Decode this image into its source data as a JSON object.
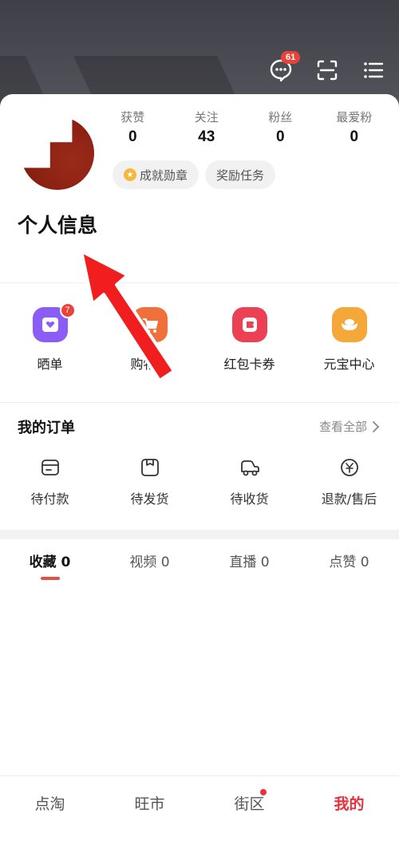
{
  "header": {
    "message_badge": "61"
  },
  "profile": {
    "stats": [
      {
        "label": "获赞",
        "value": "0"
      },
      {
        "label": "关注",
        "value": "43"
      },
      {
        "label": "粉丝",
        "value": "0"
      },
      {
        "label": "最爱粉",
        "value": "0"
      }
    ],
    "chips": {
      "badge": "成就勋章",
      "tasks": "奖励任务"
    },
    "title": "个人信息"
  },
  "quick": {
    "items": [
      {
        "label": "晒单",
        "badge": "7",
        "color": "#8b5cf6"
      },
      {
        "label": "购物车",
        "color": "#f0703c"
      },
      {
        "label": "红包卡券",
        "color": "#ec4154"
      },
      {
        "label": "元宝中心",
        "color": "#f5a83a"
      }
    ]
  },
  "orders": {
    "title": "我的订单",
    "view_all": "查看全部",
    "items": [
      {
        "label": "待付款"
      },
      {
        "label": "待发货"
      },
      {
        "label": "待收货"
      },
      {
        "label": "退款/售后"
      }
    ]
  },
  "tabs": [
    {
      "label": "收藏 0"
    },
    {
      "label": "视频 0"
    },
    {
      "label": "直播 0"
    },
    {
      "label": "点赞 0"
    }
  ],
  "bottom_nav": [
    {
      "label": "点淘"
    },
    {
      "label": "旺市"
    },
    {
      "label": "街区"
    },
    {
      "label": "我的"
    }
  ],
  "colors": {
    "accent": "#e8313a",
    "header": "#4a4a52"
  }
}
